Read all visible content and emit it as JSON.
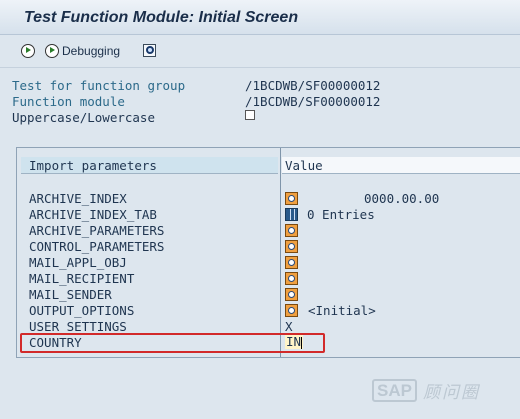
{
  "window": {
    "title": "Test Function Module: Initial Screen"
  },
  "toolbar": {
    "execute_icon": "clock-execute-icon",
    "debugging_label": "Debugging",
    "debugging_icon": "clock-execute-icon",
    "search_icon": "search-document-icon"
  },
  "header_info": {
    "function_group_label": "Test for function group",
    "function_group_value": "/1BCDWB/SF00000012",
    "function_module_label": "Function module",
    "function_module_value": "/1BCDWB/SF00000012",
    "uppercase_label": "Uppercase/Lowercase",
    "uppercase_checked": false
  },
  "params": {
    "col_import": "Import parameters",
    "col_value": "Value",
    "rows": [
      {
        "name": "ARCHIVE_INDEX",
        "icon": "structure-icon",
        "value": "0000.00.00"
      },
      {
        "name": "ARCHIVE_INDEX_TAB",
        "icon": "table-icon",
        "value": "0 Entries"
      },
      {
        "name": "ARCHIVE_PARAMETERS",
        "icon": "structure-icon",
        "value": ""
      },
      {
        "name": "CONTROL_PARAMETERS",
        "icon": "structure-icon",
        "value": ""
      },
      {
        "name": "MAIL_APPL_OBJ",
        "icon": "structure-icon",
        "value": ""
      },
      {
        "name": "MAIL_RECIPIENT",
        "icon": "structure-icon",
        "value": ""
      },
      {
        "name": "MAIL_SENDER",
        "icon": "structure-icon",
        "value": ""
      },
      {
        "name": "OUTPUT_OPTIONS",
        "icon": "structure-icon",
        "value": "<Initial>"
      },
      {
        "name": "USER_SETTINGS",
        "icon": "",
        "value": "X"
      },
      {
        "name": "COUNTRY",
        "icon": "",
        "value": "IN"
      }
    ]
  },
  "watermark": {
    "brand": "SAP",
    "suffix": "顾问圈"
  },
  "colors": {
    "title": "#1a2e4a",
    "label": "#2c6a8a",
    "highlight": "#d22a2a",
    "background": "#dde6ee"
  }
}
